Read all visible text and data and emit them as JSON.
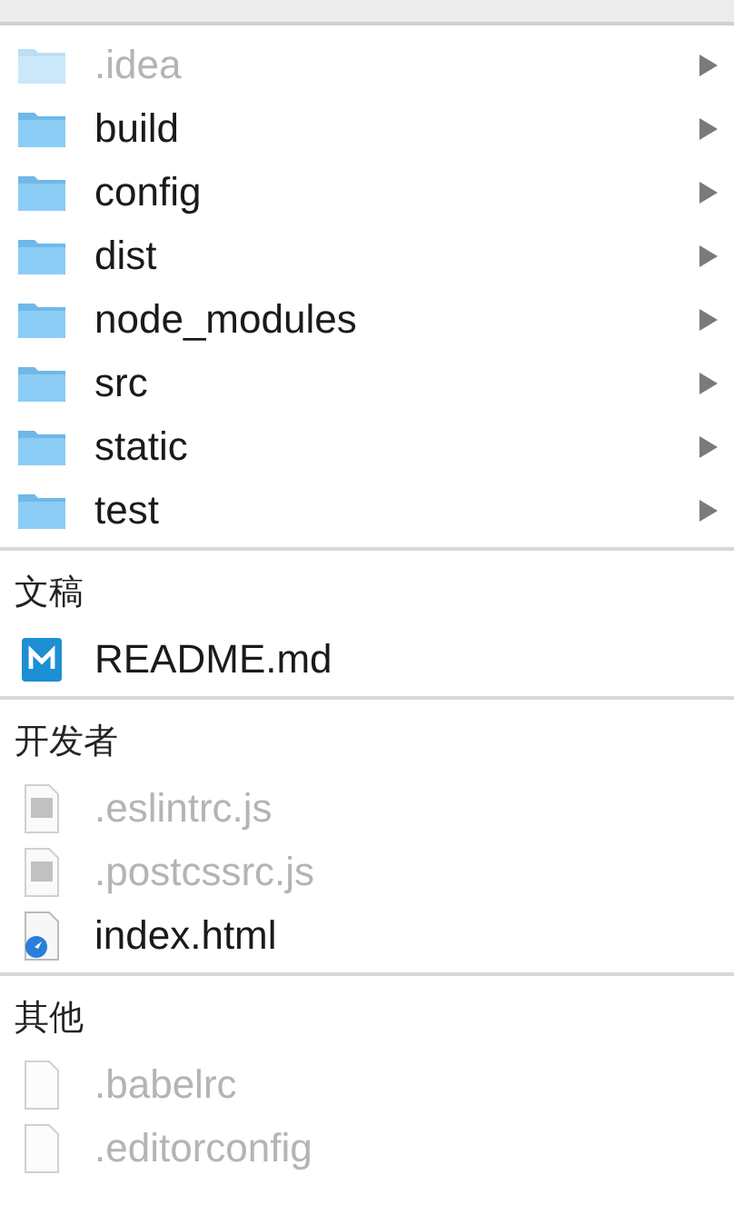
{
  "sections": [
    {
      "items": [
        {
          "name": ".idea",
          "kind": "folder",
          "dimmed": true
        },
        {
          "name": "build",
          "kind": "folder",
          "dimmed": false
        },
        {
          "name": "config",
          "kind": "folder",
          "dimmed": false
        },
        {
          "name": "dist",
          "kind": "folder",
          "dimmed": false
        },
        {
          "name": "node_modules",
          "kind": "folder",
          "dimmed": false
        },
        {
          "name": "src",
          "kind": "folder",
          "dimmed": false
        },
        {
          "name": "static",
          "kind": "folder",
          "dimmed": false
        },
        {
          "name": "test",
          "kind": "folder",
          "dimmed": false
        }
      ]
    },
    {
      "title": "文稿",
      "items": [
        {
          "name": "README.md",
          "kind": "markdown",
          "dimmed": false
        }
      ]
    },
    {
      "title": "开发者",
      "items": [
        {
          "name": ".eslintrc.js",
          "kind": "script",
          "dimmed": true
        },
        {
          "name": ".postcssrc.js",
          "kind": "script",
          "dimmed": true
        },
        {
          "name": "index.html",
          "kind": "web",
          "dimmed": false
        }
      ]
    },
    {
      "title": "其他",
      "items": [
        {
          "name": ".babelrc",
          "kind": "blank",
          "dimmed": true
        },
        {
          "name": ".editorconfig",
          "kind": "blank",
          "dimmed": true
        }
      ]
    }
  ]
}
